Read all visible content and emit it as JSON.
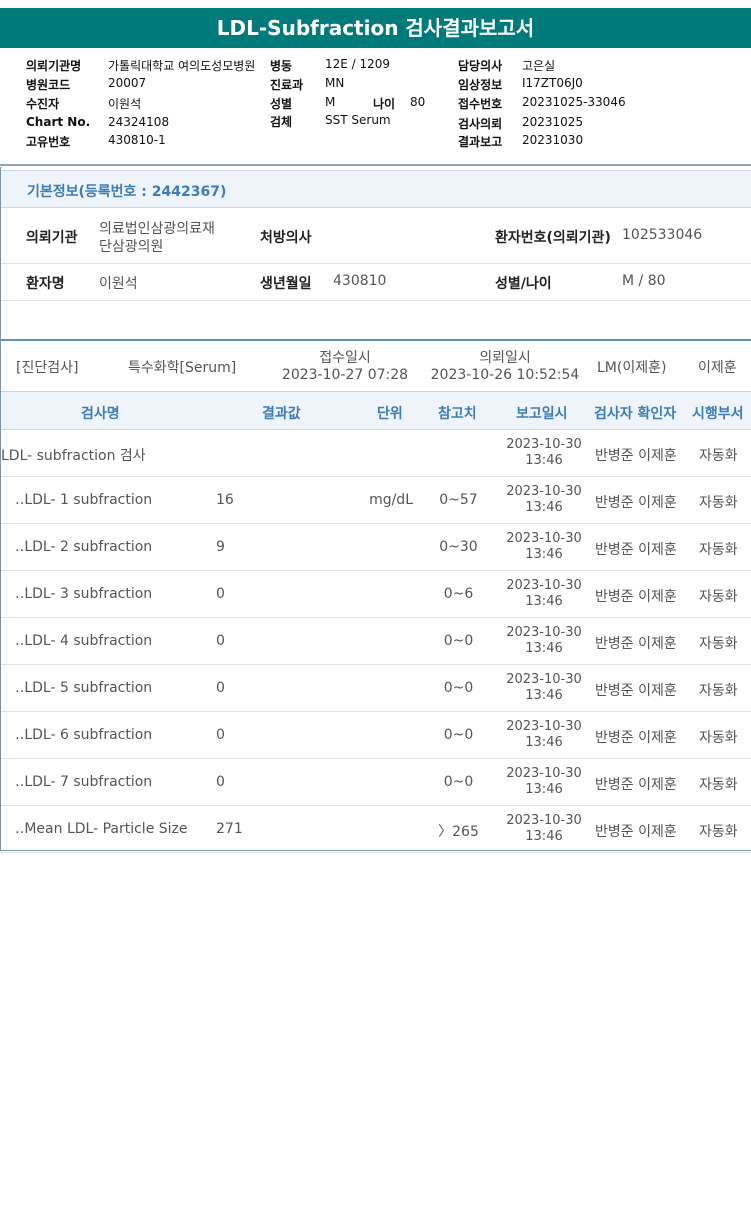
{
  "report_title": "LDL-Subfraction 검사결과보고서",
  "header": {
    "hospital_label": "의뢰기관명",
    "hospital_value": "가톨릭대학교 여의도성모병원",
    "ward_label": "병동",
    "ward_value": "12E / 1209",
    "doctor_label": "담당의사",
    "doctor_value": "고은실",
    "code_label": "병원코드",
    "code_value": "20007",
    "dept_label": "진료과",
    "dept_value": "MN",
    "clinical_label": "임상정보",
    "clinical_value": "I17ZT06J0",
    "examinee_label": "수진자",
    "examinee_value": "이원석",
    "sex_label": "성별",
    "sex_value": "M",
    "age_label": "나이",
    "age_value": "80",
    "receipt_no_label": "접수번호",
    "receipt_no_value": "20231025-33046",
    "chart_label": "Chart No.",
    "chart_value": "24324108",
    "specimen_label": "검체",
    "specimen_value": "SST Serum",
    "request_label": "검사의뢰",
    "request_value": "20231025",
    "unique_label": "고유번호",
    "unique_value": "430810-1",
    "report_label": "결과보고",
    "report_value": "20231030"
  },
  "basic_info": {
    "heading": "기본정보(등록번호 : 2442367)",
    "institution_label": "의뢰기관",
    "institution_line1": "의료법인삼광의료재",
    "institution_line2": "단삼광의원",
    "prescriber_label": "처방의사",
    "prescriber_value": "",
    "patient_no_label": "환자번호(의뢰기관)",
    "patient_no_value": "102533046",
    "name_label": "환자명",
    "name_value": "이원석",
    "birth_label": "생년월일",
    "birth_value": "430810",
    "sex_age_label": "성별/나이",
    "sex_age_value": "M / 80"
  },
  "order_meta": {
    "category": "[진단검사]",
    "specimen": "특수화학[Serum]",
    "receipt_label": "접수일시",
    "receipt_value": "2023-10-27 07:28",
    "request_label": "의뢰일시",
    "request_value": "2023-10-26 10:52:54",
    "lab": "LM(이제훈)",
    "doctor": "이제훈"
  },
  "table": {
    "headers": {
      "name": "검사명",
      "result": "결과값",
      "unit": "단위",
      "reference": "참고치",
      "report_time": "보고일시",
      "verifier": "검사자 확인자",
      "dept": "시행부서"
    },
    "rows": [
      {
        "name": "LDL- subfraction 검사",
        "result": "",
        "unit": "",
        "reference": "",
        "date": "2023-10-30",
        "time": "13:46",
        "verifier": "반병준 이제훈",
        "dept": "자동화"
      },
      {
        "name": "‥LDL- 1 subfraction",
        "result": "16",
        "unit": "mg/dL",
        "reference": "0~57",
        "date": "2023-10-30",
        "time": "13:46",
        "verifier": "반병준 이제훈",
        "dept": "자동화"
      },
      {
        "name": "‥LDL- 2 subfraction",
        "result": "9",
        "unit": "",
        "reference": "0~30",
        "date": "2023-10-30",
        "time": "13:46",
        "verifier": "반병준 이제훈",
        "dept": "자동화"
      },
      {
        "name": "‥LDL- 3 subfraction",
        "result": "0",
        "unit": "",
        "reference": "0~6",
        "date": "2023-10-30",
        "time": "13:46",
        "verifier": "반병준 이제훈",
        "dept": "자동화"
      },
      {
        "name": "‥LDL- 4 subfraction",
        "result": "0",
        "unit": "",
        "reference": "0~0",
        "date": "2023-10-30",
        "time": "13:46",
        "verifier": "반병준 이제훈",
        "dept": "자동화"
      },
      {
        "name": "‥LDL- 5 subfraction",
        "result": "0",
        "unit": "",
        "reference": "0~0",
        "date": "2023-10-30",
        "time": "13:46",
        "verifier": "반병준 이제훈",
        "dept": "자동화"
      },
      {
        "name": "‥LDL- 6 subfraction",
        "result": "0",
        "unit": "",
        "reference": "0~0",
        "date": "2023-10-30",
        "time": "13:46",
        "verifier": "반병준 이제훈",
        "dept": "자동화"
      },
      {
        "name": "‥LDL- 7 subfraction",
        "result": "0",
        "unit": "",
        "reference": "0~0",
        "date": "2023-10-30",
        "time": "13:46",
        "verifier": "반병준 이제훈",
        "dept": "자동화"
      },
      {
        "name": "‥Mean LDL- Particle Size",
        "result": "271",
        "unit": "",
        "reference": "〉265",
        "date": "2023-10-30",
        "time": "13:46",
        "verifier": "반병준 이제훈",
        "dept": "자동화"
      }
    ]
  },
  "colors": {
    "title_bg": "#007a7a",
    "section_text": "#3d7db5",
    "section_bg": "#eef4f9"
  }
}
